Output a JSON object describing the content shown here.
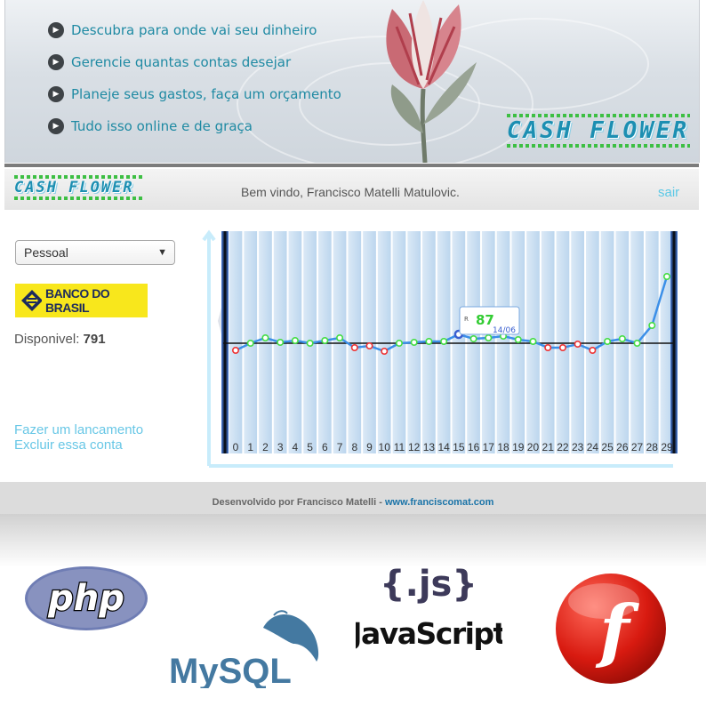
{
  "banner": {
    "bullets": [
      "Descubra para onde vai seu dinheiro",
      "Gerencie quantas contas desejar",
      "Planeje seus gastos, faça um orçamento",
      "Tudo isso online e de graça"
    ],
    "logo": "CASH FLOWER"
  },
  "header": {
    "logo": "CASH FLOWER",
    "welcome": "Bem vindo, Francisco Matelli Matulovic.",
    "logout": "sair"
  },
  "sidebar": {
    "account": "Pessoal",
    "bank": "BANCO DO BRASIL",
    "available_label": "Disponivel: ",
    "available_value": "791",
    "links": [
      "Fazer um lancamento",
      "Excluir essa conta"
    ]
  },
  "chart_data": {
    "type": "line",
    "x": [
      0,
      1,
      2,
      3,
      4,
      5,
      6,
      7,
      8,
      9,
      10,
      11,
      12,
      13,
      14,
      15,
      16,
      17,
      18,
      19,
      20,
      21,
      22,
      23,
      24,
      25,
      26,
      27,
      28,
      29
    ],
    "y": [
      -8,
      0,
      6,
      1,
      3,
      0,
      3,
      6,
      -5,
      -3,
      -9,
      0,
      1,
      2,
      2,
      10,
      5,
      6,
      8,
      4,
      2,
      -5,
      -5,
      -1,
      -8,
      2,
      5,
      0,
      20,
      75
    ],
    "tooltip": {
      "flag": "R",
      "value": "87",
      "date": "14/06"
    },
    "colors": {
      "positive": "#44dd44",
      "negative": "#ee3333",
      "highlight": "#3a5fd0",
      "line": "#3b8fe8"
    }
  },
  "footer": {
    "prefix": "Desenvolvido por Francisco Matelli - ",
    "link": "www.franciscomat.com"
  },
  "logos": {
    "php": "php",
    "mysql": "MySQL",
    "js_badge": "{.js}",
    "js_name": "JavaScript",
    "flash": "f"
  }
}
